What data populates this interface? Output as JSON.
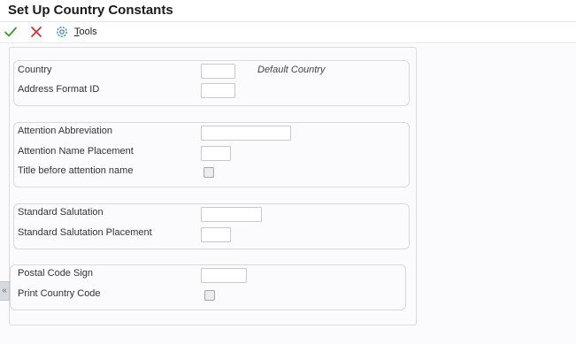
{
  "header": {
    "title": "Set Up Country Constants"
  },
  "toolbar": {
    "ok_icon": "checkmark-icon",
    "cancel_icon": "x-icon",
    "tools_icon": "gear-icon",
    "tools_label_first": "T",
    "tools_label_rest": "ools",
    "ok_color": "#3a9a2a",
    "cancel_color": "#d9242a",
    "tools_color": "#2e7fc4"
  },
  "form": {
    "country": {
      "label": "Country",
      "value": "",
      "note": "Default Country"
    },
    "address_format": {
      "label": "Address Format ID",
      "value": ""
    },
    "attention_abbreviation": {
      "label": "Attention Abbreviation",
      "value": ""
    },
    "attention_name_placement": {
      "label": "Attention Name Placement",
      "value": ""
    },
    "title_before_attention": {
      "label": "Title before attention name",
      "checked": false
    },
    "standard_salutation": {
      "label": "Standard Salutation",
      "value": ""
    },
    "standard_salutation_placement": {
      "label": "Standard Salutation Placement",
      "value": ""
    },
    "postal_code_sign": {
      "label": "Postal Code Sign",
      "value": ""
    },
    "print_country_code": {
      "label": "Print Country Code",
      "checked": false
    }
  },
  "sidebar_toggle": {
    "glyph": "«"
  }
}
